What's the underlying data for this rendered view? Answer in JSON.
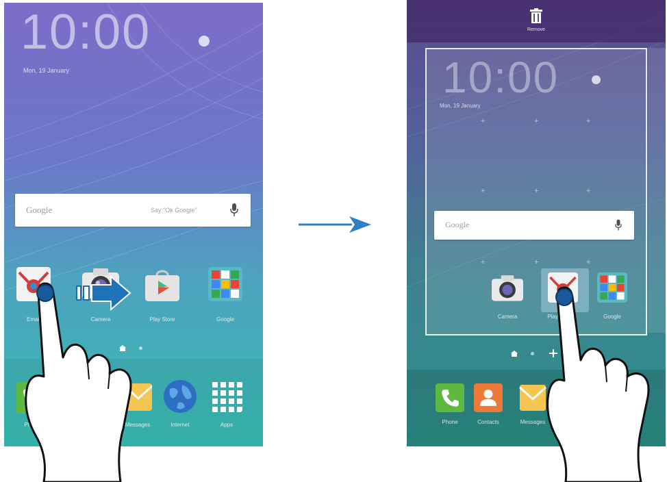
{
  "left_screen": {
    "clock": "10:00",
    "date": "Mon, 19 January",
    "search": {
      "logo": "Google",
      "hint": "Say \"Ok Google\""
    },
    "apps": [
      {
        "label": "Email",
        "icon": "email-icon"
      },
      {
        "label": "Camera",
        "icon": "camera-icon"
      },
      {
        "label": "Play Store",
        "icon": "play-store-icon"
      },
      {
        "label": "Google",
        "icon": "google-folder-icon"
      }
    ],
    "dock": [
      {
        "label": "Phone",
        "icon": "phone-icon"
      },
      {
        "label": "Messages",
        "icon": "messages-icon"
      },
      {
        "label": "Internet",
        "icon": "globe-icon"
      },
      {
        "label": "Apps",
        "icon": "apps-grid-icon"
      }
    ]
  },
  "right_screen": {
    "remove_label": "Remove",
    "clock": "10:00",
    "date": "Mon, 19 January",
    "search": {
      "logo": "Google"
    },
    "apps": [
      {
        "label": "Camera",
        "icon": "camera-icon"
      },
      {
        "label": "Play",
        "icon": "email-icon"
      },
      {
        "label": "Google",
        "icon": "google-folder-icon"
      }
    ],
    "dock": [
      {
        "label": "Phone",
        "icon": "phone-icon"
      },
      {
        "label": "Contacts",
        "icon": "contacts-icon"
      },
      {
        "label": "Messages",
        "icon": "messages-icon"
      }
    ]
  },
  "colors": {
    "arrow": "#2e7fc4",
    "wall_top": "#7a6bc4",
    "wall_bottom": "#3fb6b0"
  }
}
